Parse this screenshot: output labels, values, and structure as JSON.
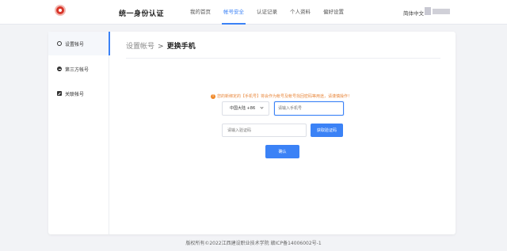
{
  "header": {
    "title": "统一身份认证",
    "nav": [
      {
        "label": "我的首页",
        "active": false
      },
      {
        "label": "帐号安全",
        "active": true
      },
      {
        "label": "认证记录",
        "active": false
      },
      {
        "label": "个人资料",
        "active": false
      },
      {
        "label": "偏好设置",
        "active": false
      }
    ],
    "language": "简体中文"
  },
  "sidebar": {
    "items": [
      {
        "label": "设置帐号",
        "icon": "gear-icon",
        "active": true
      },
      {
        "label": "第三方帐号",
        "icon": "link-circle-icon",
        "active": false
      },
      {
        "label": "关联帐号",
        "icon": "bind-icon",
        "active": false
      }
    ]
  },
  "breadcrumb": {
    "parent": "设置帐号",
    "separator": ">",
    "current": "更换手机"
  },
  "form": {
    "notice": "您的新绑定的【手机号】将会作为帐号及帐号找回密码等用途，请谨慎操作！",
    "country_code": "中国大陆 +86",
    "phone_placeholder": "请输入手机号",
    "code_placeholder": "请输入验证码",
    "get_code_label": "获取验证码",
    "confirm_label": "确认"
  },
  "footer": {
    "text": "版权所有©2022江西建设职业技术学院 赣ICP备14006002号-1"
  },
  "colors": {
    "accent": "#3b82f6",
    "warning": "#e8863a",
    "logo": "#d8362a"
  }
}
